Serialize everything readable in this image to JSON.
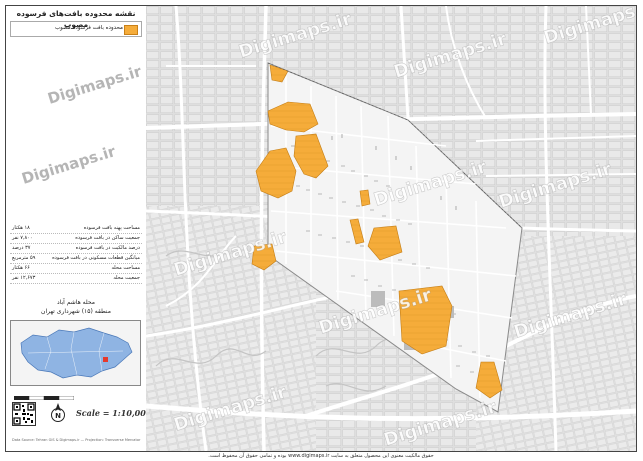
{
  "legend": {
    "title": "نقشه محدوده بافت‌های فرسوده مصوب",
    "key_label": "محدوده بافت فرسوده مصوب",
    "key_color": "#f5ac3a"
  },
  "stats": [
    {
      "label": "مساحت پهنه بافت فرسوده",
      "value": "۱۸ هکتار"
    },
    {
      "label": "جمعیت ساکن در بافت فرسوده",
      "value": "۷,۸۰۰ نفر"
    },
    {
      "label": "درصد مالکیت در بافت فرسوده",
      "value": "۳۷ درصد"
    },
    {
      "label": "میانگین قطعات مسکونی در بافت فرسوده",
      "value": "۵۹ مترمربع"
    },
    {
      "label": "مساحت محله",
      "value": "۶۶ هکتار"
    },
    {
      "label": "جمعیت محله",
      "value": "۱۲,۶۷۳ نفر"
    }
  ],
  "location": {
    "neighborhood": "محله هاشم آباد",
    "district": "منطقه (۱۵) شهرداری تهران"
  },
  "scale": "Scale = 1:10,000",
  "north_label": "N",
  "credit": "Data Source: Tehran GIS & Digimaps.ir — Projection: Transverse Mercator",
  "footer": "حقوق مالکیت معنوی این محصول متعلق به سایت www.digimaps.ir بوده و تمامی حقوق آن محفوظ است.",
  "watermark": "Digimaps.ir",
  "map_colors": {
    "background": "#dcdcdc",
    "block": "#ececec",
    "road": "#ffffff",
    "highlight": "#f5ac3a"
  }
}
